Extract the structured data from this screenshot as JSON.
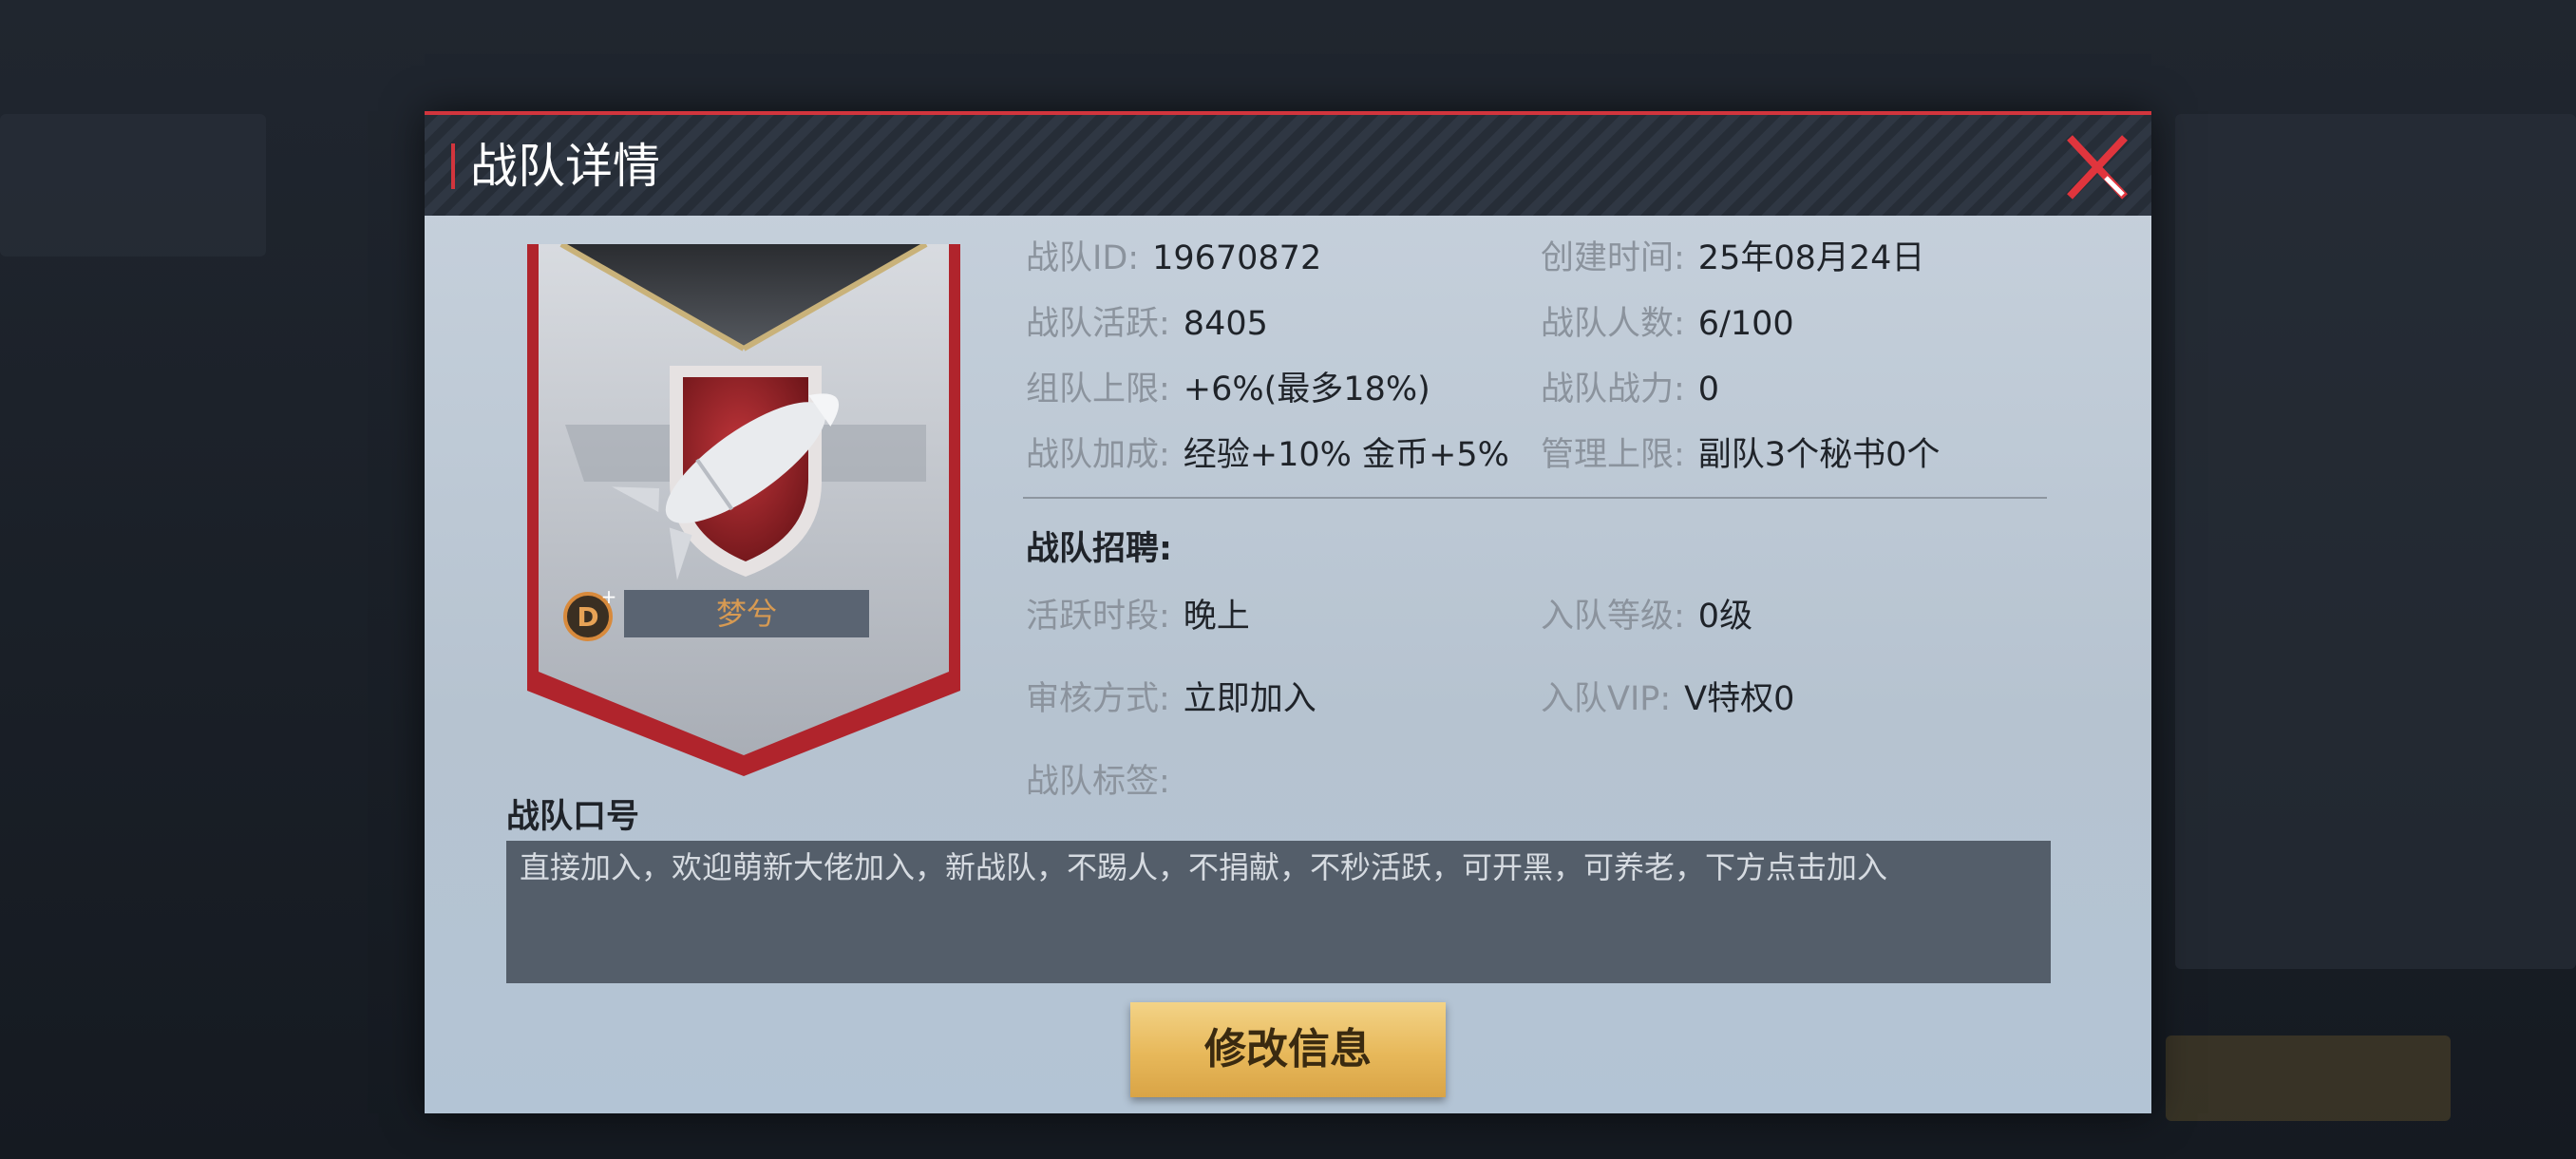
{
  "dialog": {
    "title": "战队详情",
    "accent_color": "#d2353d"
  },
  "banner": {
    "clan_name": "梦兮",
    "emblem": "rocket-shield-emblem",
    "rank_badge_icon": "d-plus-rank-icon"
  },
  "info": {
    "clan_id_label": "战队ID:",
    "clan_id": "19670872",
    "created_label": "创建时间:",
    "created": "25年08月24日",
    "activity_label": "战队活跃:",
    "activity": "8405",
    "members_label": "战队人数:",
    "members": "6/100",
    "team_limit_label": "组队上限:",
    "team_limit": "+6%(最多18%)",
    "power_label": "战队战力:",
    "power": "0",
    "bonus_label": "战队加成:",
    "bonus": "经验+10% 金币+5%",
    "admin_limit_label": "管理上限:",
    "admin_limit": "副队3个秘书0个"
  },
  "recruit": {
    "section_title": "战队招聘:",
    "active_time_label": "活跃时段:",
    "active_time": "晚上",
    "join_level_label": "入队等级:",
    "join_level": "0级",
    "review_label": "审核方式:",
    "review": "立即加入",
    "join_vip_label": "入队VIP:",
    "join_vip": "V特权0",
    "tags_label": "战队标签:"
  },
  "slogan": {
    "title": "战队口号",
    "text": "直接加入，欢迎萌新大佬加入，新战队，不踢人，不捐献，不秒活跃，可开黑，可养老，下方点击加入"
  },
  "actions": {
    "edit_label": "修改信息"
  }
}
